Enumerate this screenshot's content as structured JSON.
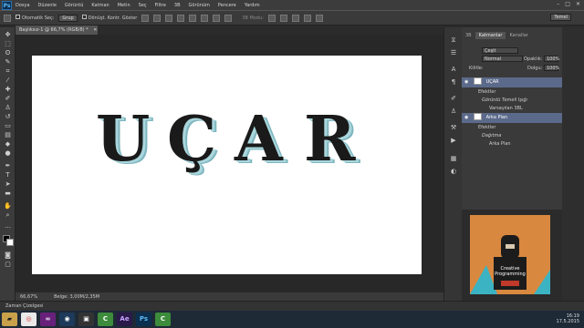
{
  "app": {
    "logo": "Ps",
    "title": "Başlıksız-1 @ 66,7% (RGB/8) *"
  },
  "menu": [
    "Dosya",
    "Düzenle",
    "Görüntü",
    "Katman",
    "Metin",
    "Seç",
    "Filtre",
    "3B",
    "Görünüm",
    "Pencere",
    "Yardım"
  ],
  "options": {
    "auto_select_label": "Otomatik Seç:",
    "group_value": "Grup",
    "transform_label": "Dönüşt. Kontr. Göster",
    "mode_3d": "3B Modu:",
    "workspace": "Temel"
  },
  "canvas": {
    "letters": [
      "U",
      "Ç",
      "A",
      "R"
    ],
    "background": "#ffffff",
    "shadow_colors": [
      "#a9d6dc",
      "#7fb6bf"
    ]
  },
  "status": {
    "zoom": "66,67%",
    "doc_size": "Belge: 3,00M/2,35M"
  },
  "timeline": {
    "label": "Zaman Çizelgesi"
  },
  "layers_panel": {
    "tabs": [
      "3B",
      "Katmanlar",
      "Kanallar"
    ],
    "filter": "Çeşit",
    "blend_mode": "Normal",
    "opacity_label": "Opaklık:",
    "opacity_value": "100%",
    "lock_label": "Kilitle:",
    "fill_label": "Dolgu:",
    "fill_value": "100%",
    "rows": [
      {
        "name": "UÇAR",
        "selected": true
      },
      {
        "name": "Efektler",
        "selected": false
      },
      {
        "name": "Görüntü Temeli Işığı",
        "selected": false
      },
      {
        "name": "Varsayılan 3BL",
        "selected": false
      },
      {
        "name": "Arka Plan",
        "selected": true
      },
      {
        "name": "Efektler",
        "selected": false
      },
      {
        "name": "Dağıtma",
        "selected": false
      },
      {
        "name": "Arka Plan",
        "selected": false
      }
    ]
  },
  "video": {
    "caption": "Creative Programming",
    "accent": "#d9883f"
  },
  "taskbar": {
    "apps": [
      "Explorer",
      "Chrome",
      "Visual Studio",
      "Cinema 4D",
      "Media",
      "Camtasia",
      "After Effects",
      "Photoshop",
      "Camtasia"
    ],
    "time": "16:19",
    "date": "17.5.2015"
  }
}
